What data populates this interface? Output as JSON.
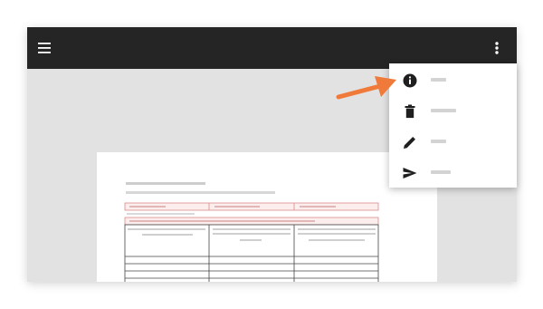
{
  "app_bar": {
    "menu_icon": "hamburger-menu-icon",
    "more_icon": "more-vert-icon"
  },
  "overflow_menu": {
    "items": [
      {
        "icon": "info-icon",
        "label": ""
      },
      {
        "icon": "delete-icon",
        "label": ""
      },
      {
        "icon": "edit-icon",
        "label": ""
      },
      {
        "icon": "send-icon",
        "label": ""
      }
    ]
  },
  "annotation": {
    "arrow_color": "#f07a3a"
  },
  "colors": {
    "app_bar": "#252525",
    "canvas": "#e2e2e2",
    "table_header_tint": "#fdeeee",
    "table_border": "#d98a8a"
  }
}
